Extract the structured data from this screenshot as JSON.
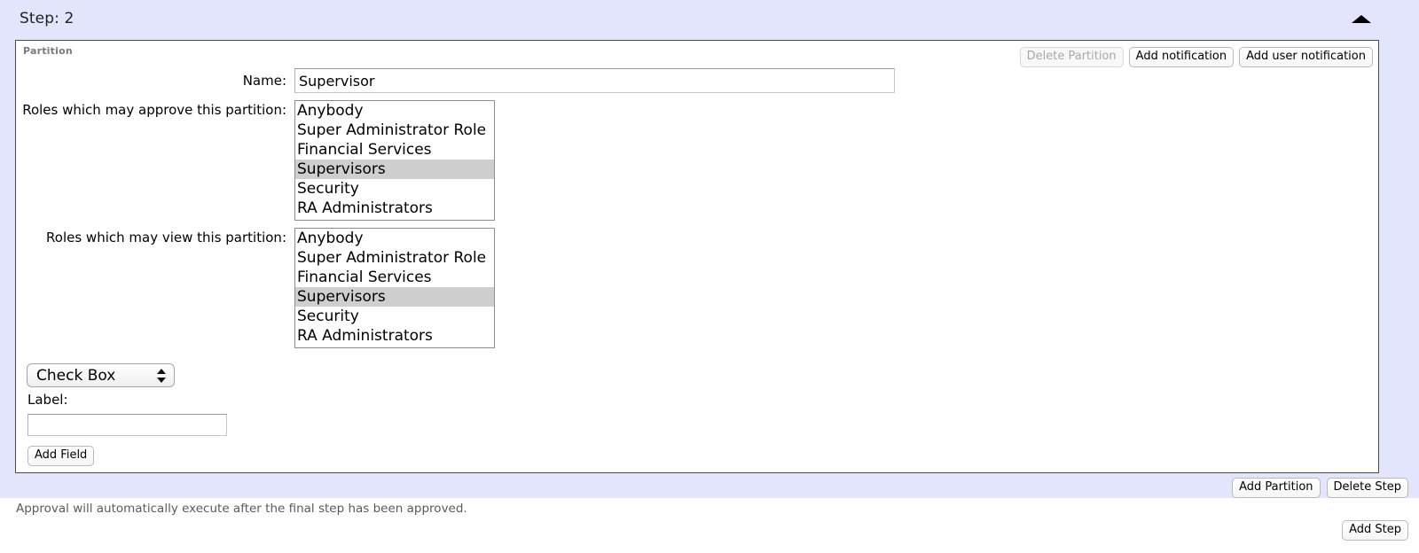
{
  "step": {
    "title": "Step: 2",
    "collapse_icon": "triangle-up-icon"
  },
  "partition": {
    "legend": "Partition",
    "tools": [
      {
        "label": "Delete Partition",
        "name": "delete-partition-button",
        "disabled": true
      },
      {
        "label": "Add notification",
        "name": "add-notification-button",
        "disabled": false
      },
      {
        "label": "Add user notification",
        "name": "add-user-notification-button",
        "disabled": false
      }
    ],
    "name_field": {
      "label": "Name:",
      "value": "Supervisor",
      "placeholder": ""
    },
    "approve_roles": {
      "label": "Roles which may approve this partition:",
      "options": [
        "Anybody",
        "Super Administrator Role",
        "Financial Services",
        "Supervisors",
        "Security",
        "RA Administrators"
      ],
      "selected": "Supervisors"
    },
    "view_roles": {
      "label": "Roles which may view this partition:",
      "options": [
        "Anybody",
        "Super Administrator Role",
        "Financial Services",
        "Supervisors",
        "Security",
        "RA Administrators"
      ],
      "selected": "Supervisors"
    },
    "field_type_select": {
      "value": "Check Box",
      "arrows_icon": "updown-arrows-icon"
    },
    "field_label": {
      "label": "Label:",
      "value": "",
      "placeholder": ""
    },
    "add_field_button": "Add Field"
  },
  "step_footer": {
    "add_partition": "Add Partition",
    "delete_step": "Delete Step"
  },
  "note": "Approval will automatically execute after the final step has been approved.",
  "page_footer": {
    "add_step": "Add Step"
  },
  "colors": {
    "panel_background": "#e2e5fb",
    "page_background": "#ffffff",
    "selected_row": "#cfcfcf",
    "legend_text": "#7b7b7b",
    "note_text": "#5b5b5b",
    "disabled_text": "#a9a9a9"
  }
}
